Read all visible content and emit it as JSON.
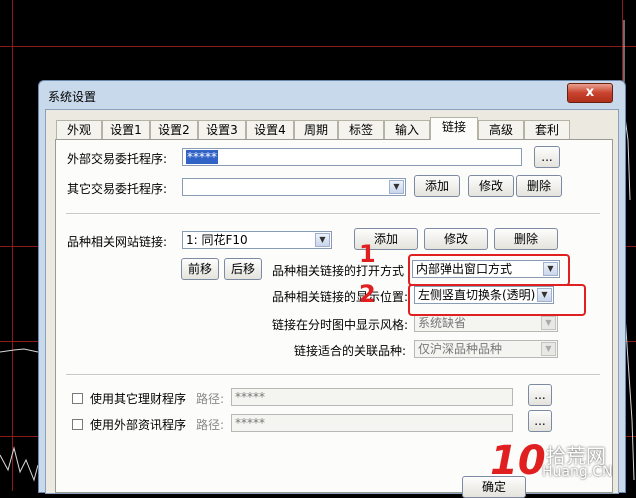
{
  "window": {
    "title": "系统设置",
    "close_label": "x"
  },
  "tabs": [
    {
      "label": "外观"
    },
    {
      "label": "设置1"
    },
    {
      "label": "设置2"
    },
    {
      "label": "设置3"
    },
    {
      "label": "设置4"
    },
    {
      "label": "周期"
    },
    {
      "label": "标签"
    },
    {
      "label": "输入"
    },
    {
      "label": "链接",
      "active": true
    },
    {
      "label": "高级"
    },
    {
      "label": "套利"
    }
  ],
  "trade": {
    "external_label": "外部交易委托程序:",
    "external_value": "*****",
    "browse_label": "...",
    "other_label": "其它交易委托程序:",
    "other_value": "",
    "add_label": "添加",
    "modify_label": "修改",
    "delete_label": "删除"
  },
  "links": {
    "site_label": "品种相关网站链接:",
    "site_value": "1: 同花F10",
    "add_label": "添加",
    "modify_label": "修改",
    "delete_label": "删除",
    "prev_label": "前移",
    "next_label": "后移",
    "open_label": "品种相关链接的打开方式",
    "open_value": "内部弹出窗口方式",
    "display_label": "品种相关链接的显示位置:",
    "display_value": "左侧竖直切换条(透明)",
    "timeshare_label": "链接在分时图中显示风格:",
    "timeshare_value": "系统缺省",
    "assoc_label": "链接适合的关联品种:",
    "assoc_value": "仅沪深品种品种"
  },
  "other_programs": {
    "finance_label": "使用其它理财程序",
    "finance_path_label": "路径:",
    "finance_path": "*****",
    "info_label": "使用外部资讯程序",
    "info_path_label": "路径:",
    "info_path": "*****",
    "browse_label": "..."
  },
  "footer": {
    "ok_label": "确定"
  },
  "annotations": {
    "one": "1",
    "two": "2"
  },
  "watermark": {
    "number": "10",
    "text": "拾荒网",
    "domain": "Huang.CN"
  },
  "colors": {
    "annotation": "#e02020",
    "selection": "#3163c6",
    "dialog_frame": "#c9d9ec"
  }
}
